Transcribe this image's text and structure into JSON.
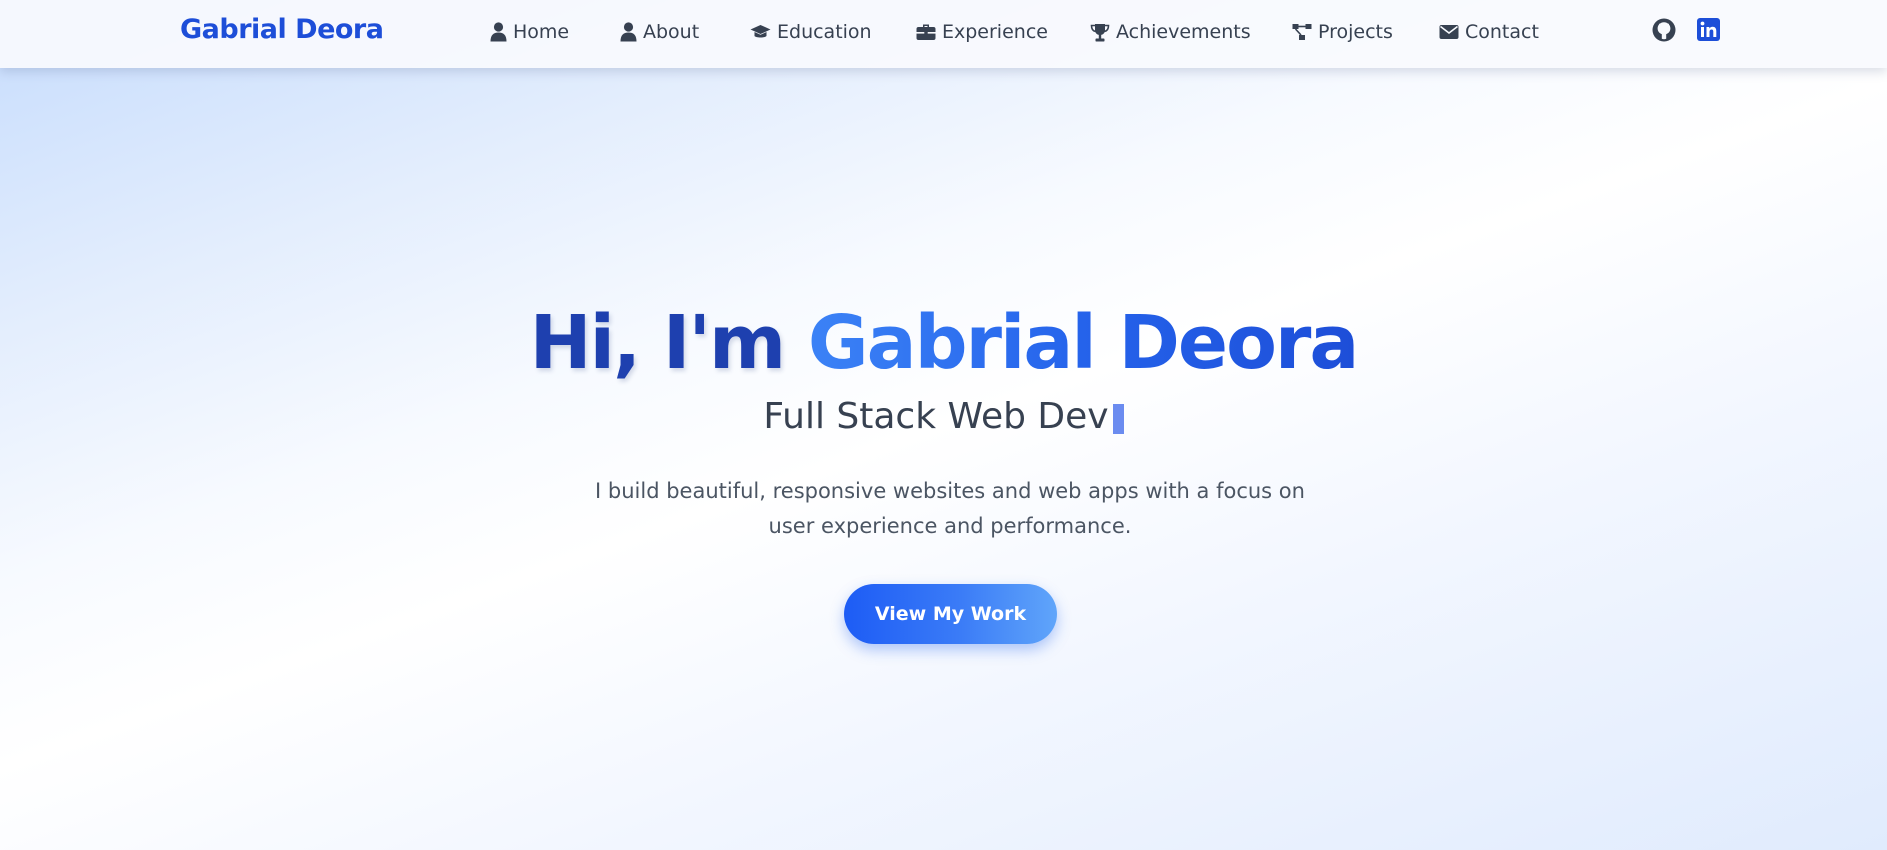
{
  "brand": {
    "name": "Gabrial Deora"
  },
  "nav": {
    "items": [
      {
        "label": "Home",
        "icon": "user-icon"
      },
      {
        "label": "About",
        "icon": "user-icon"
      },
      {
        "label": "Education",
        "icon": "graduation-cap-icon"
      },
      {
        "label": "Experience",
        "icon": "briefcase-icon"
      },
      {
        "label": "Achievements",
        "icon": "trophy-icon"
      },
      {
        "label": "Projects",
        "icon": "project-diagram-icon"
      },
      {
        "label": "Contact",
        "icon": "envelope-icon"
      }
    ],
    "social": [
      {
        "name": "github-icon"
      },
      {
        "name": "linkedin-icon"
      }
    ]
  },
  "hero": {
    "greeting": "Hi, I'm ",
    "name": "Gabrial Deora",
    "typed_text": "Full Stack Web Dev",
    "description": "I build beautiful, responsive websites and web apps with a focus on user experience and performance.",
    "cta_label": "View My Work"
  },
  "colors": {
    "accent": "#1d4ed8",
    "accent_light": "#3b82f6",
    "text": "#374151",
    "muted": "#4b5563",
    "cursor": "#6b8cf0"
  }
}
